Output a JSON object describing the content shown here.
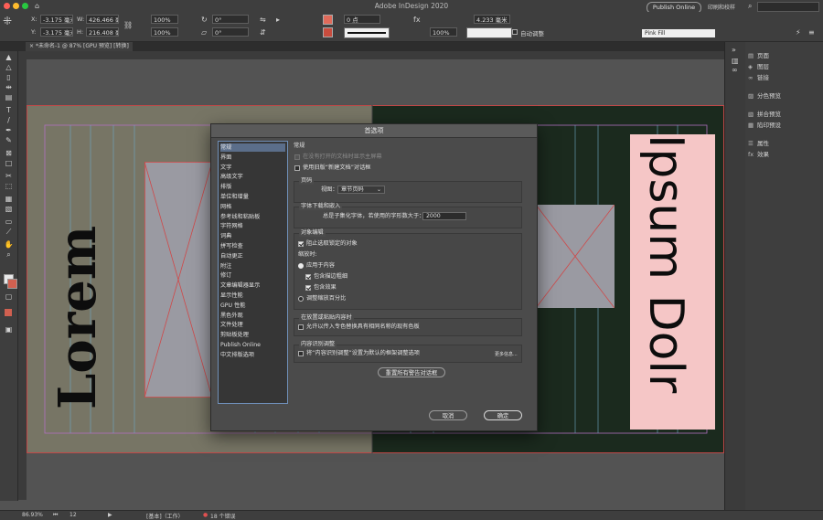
{
  "app": {
    "title": "Adobe InDesign 2020",
    "publish_online": "Publish Online",
    "workspace": "印刷和校样",
    "search_placeholder": ""
  },
  "control_bar": {
    "x_label": "X:",
    "x_value": "-3.175 毫米",
    "y_label": "Y:",
    "y_value": "-3.175 毫米",
    "w_label": "W:",
    "w_value": "426.466 毫",
    "h_label": "H:",
    "h_value": "216.408 毫",
    "scale_x": "100%",
    "scale_y": "100%",
    "rotate": "0°",
    "shear": "0°",
    "stroke_weight": "0 点",
    "spacing_value": "4.233 毫米",
    "auto_fit_label": "自动调整",
    "object_style": "Pink Fill",
    "opacity_value": "100%"
  },
  "document_tab": {
    "label": "*未命名-1 @ 87% [GPU 预览] [转换]"
  },
  "right_panel": {
    "items": [
      {
        "label": "页面",
        "icon": "pages-icon"
      },
      {
        "label": "图层",
        "icon": "layers-icon"
      },
      {
        "label": "链接",
        "icon": "links-icon"
      },
      {
        "label": "分色预览",
        "icon": "separations-icon"
      },
      {
        "label": "拼合预览",
        "icon": "flattener-icon"
      },
      {
        "label": "陷印预设",
        "icon": "trap-icon"
      },
      {
        "label": "属性",
        "icon": "properties-icon"
      },
      {
        "label": "效果",
        "icon": "effects-icon"
      }
    ]
  },
  "canvas": {
    "text_left": "Lorem",
    "text_right": "Ipsum Dolr"
  },
  "status_bar": {
    "zoom": "86.93%",
    "page": "12",
    "profile": "[基本]（工作）",
    "errors": "18 个错误"
  },
  "dialog": {
    "title": "首选项",
    "categories": [
      "常规",
      "界面",
      "文字",
      "高级文字",
      "排版",
      "单位和增量",
      "网格",
      "参考线和粘贴板",
      "字符网格",
      "词典",
      "拼写检查",
      "自动更正",
      "附注",
      "修订",
      "文章编辑器显示",
      "显示性能",
      "GPU 性能",
      "黑色外观",
      "文件处理",
      "剪贴板处理",
      "Publish Online",
      "中文排版选项"
    ],
    "selected_index": 0,
    "section_title": "常规",
    "startup_workspace": "在没有打开的文档时显示主屏幕",
    "legacy_new_doc": "使用旧版“新建文档”对话框",
    "page_numbering_group": "页码",
    "view_label": "视图：",
    "view_value": "章节页码",
    "font_group": "字体下载和嵌入",
    "font_subset_label": "总是子集化字体，若使用的字形数大于：",
    "font_subset_value": "2000",
    "object_edit_group": "对象编辑",
    "prevent_locked": "阻止选取锁定的对象",
    "scale_label": "缩放时:",
    "apply_to_content": "应用于内容",
    "include_stroke": "包含描边粗细",
    "include_effects": "包含效果",
    "adjust_scale_pct": "调整缩放百分比",
    "paste_group": "在放置或粘贴内容时",
    "allow_incoming_swatch": "允许以传入专色替换具有相同名称的现有色板",
    "content_aware_group": "内容识别调整",
    "content_aware_default": "将“内容识别调整”设置为默认的框架调整选项",
    "more_info": "更多信息...",
    "reset_warnings": "重置所有警告对话框",
    "cancel": "取消",
    "ok": "确定"
  }
}
